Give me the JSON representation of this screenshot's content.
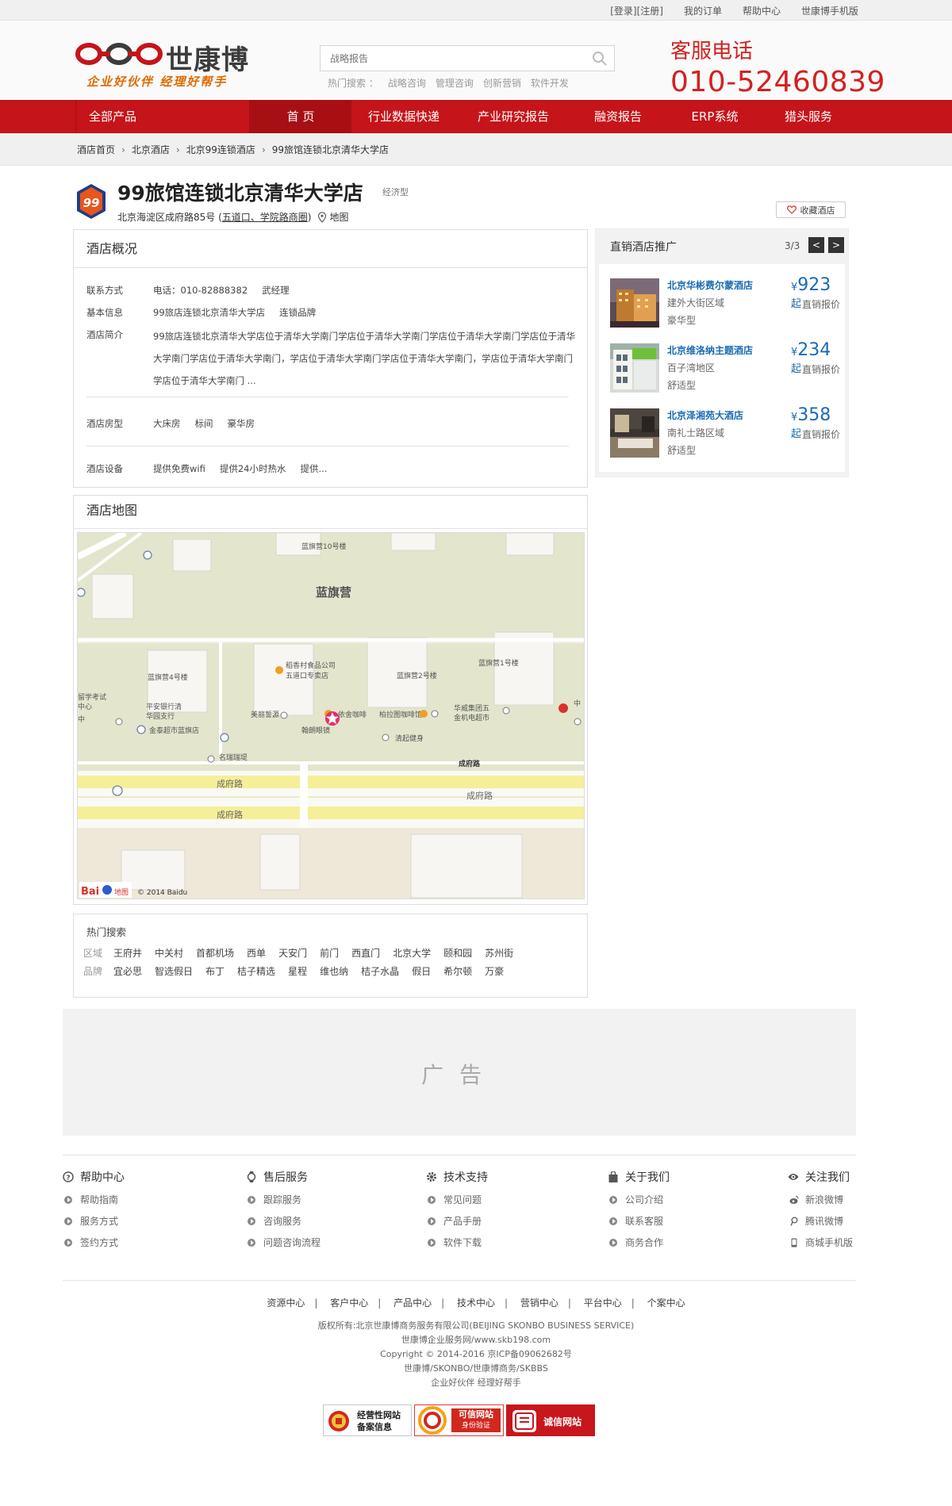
{
  "topbar": {
    "login": "[登录]",
    "register": "[注册]",
    "orders": "我的订单",
    "help": "帮助中心",
    "mobile": "世康博手机版"
  },
  "header": {
    "brand_name": "世康博",
    "slogan": "企业好伙伴  经理好帮手",
    "search_placeholder": "战略报告",
    "hot_label": "热门搜索 ：",
    "hot_items": [
      "战略咨询",
      "管理咨询",
      "创新营销",
      "软件开发"
    ],
    "hotline_title": "客服电话",
    "hotline_number": "010-52460839"
  },
  "nav": {
    "all": "全部产品",
    "items": [
      "首 页",
      "行业数据快递",
      "产业研究报告",
      "融资报告",
      "ERP系统",
      "猎头服务"
    ]
  },
  "breadcrumb": [
    "酒店首页",
    "北京酒店",
    "北京99连锁酒店",
    "99旅馆连锁北京清华大学店"
  ],
  "hotel": {
    "logo_text": "99",
    "name": "99旅馆连锁北京清华大学店",
    "type": "经济型",
    "address_prefix": "北京海淀区成府路85号 (",
    "address_area": "五道口、学院路商圈",
    "address_suffix": ")",
    "map_link": "地图",
    "favorite": "收藏酒店"
  },
  "overview": {
    "title": "酒店概况",
    "contact_label": "联系方式",
    "contact_phone": "电话：010-82888382",
    "contact_person": "武经理",
    "basic_label": "基本信息",
    "basic_name": "99旅店连锁北京清华大学店",
    "basic_brand": "连锁品牌",
    "intro_label": "酒店简介",
    "intro_text": "99旅店连锁北京清华大学店位于清华大学南门学店位于清华大学南门学店位于清华大学南门学店位于清华大学南门学店位于清华大学南门，学店位于清华大学南门学店位于清华大学南门，学店位于清华大学南门学店位于清华大学南门 ...",
    "rooms_label": "酒店房型",
    "rooms": [
      "大床房",
      "标间",
      "豪华房"
    ],
    "facilities_label": "酒店设备",
    "facilities": [
      "提供免费wifi",
      "提供24小时热水",
      "提供..."
    ]
  },
  "map": {
    "title": "酒店地图",
    "labels": {
      "district": "蓝旗营",
      "b10": "蓝旗营10号楼",
      "b4": "蓝旗营4号楼",
      "b2": "蓝旗营2号楼",
      "b1": "蓝旗营1号楼",
      "shop1": "稻香村食品公司",
      "shop2": "五道口专卖店",
      "bank1": "平安银行清",
      "bank2": "华园支行",
      "super": "金泰超市蓝旗店",
      "edu": "留学考试",
      "center": "中心",
      "mid": "中",
      "beauty": "美丽誓源",
      "glasses": "翰朗眼镜",
      "cafe": "依舍咖啡",
      "cafe2": "柏拉图咖啡馆",
      "tech1": "华威集团五",
      "tech2": "金机电超市",
      "gym": "清起健身",
      "mingrui": "名瑞瑞堤",
      "road1": "成府路",
      "road2": "成府路",
      "road3": "成府路",
      "road4": "成府路",
      "copyright": "© 2014 Baidu",
      "baidu": "Bai",
      "baidu2": "地图"
    }
  },
  "hot_search": {
    "title": "热门搜索",
    "area_label": "区域",
    "areas": [
      "王府井",
      "中关村",
      "首都机场",
      "西单",
      "天安门",
      "前门",
      "西直门",
      "北京大学",
      "颐和园",
      "苏州街"
    ],
    "brand_label": "品牌",
    "brands": [
      "宜必思",
      "智选假日",
      "布丁",
      "桔子精选",
      "星程",
      "维也纳",
      "桔子水晶",
      "假日",
      "希尔顿",
      "万豪"
    ]
  },
  "ad": {
    "label": "广告"
  },
  "promo": {
    "title": "直销酒店推广",
    "page": "3/3",
    "prev": "<",
    "next": ">",
    "hotels": [
      {
        "name": "北京华彬费尔蒙酒店",
        "area": "建外大街区域",
        "type": "豪华型",
        "currency": "¥",
        "price": "923",
        "unit": "起",
        "desc": "直销报价"
      },
      {
        "name": "北京维洛纳主题酒店",
        "area": "百子湾地区",
        "type": "舒适型",
        "currency": "¥",
        "price": "234",
        "unit": "起",
        "desc": "直销报价"
      },
      {
        "name": "北京泽湘苑大酒店",
        "area": "南礼士路区域",
        "type": "舒适型",
        "currency": "¥",
        "price": "358",
        "unit": "起",
        "desc": "直销报价"
      }
    ]
  },
  "footer": {
    "cols": [
      {
        "title": "帮助中心",
        "icon": "question-icon",
        "items": [
          "帮助指南",
          "服务方式",
          "签约方式"
        ]
      },
      {
        "title": "售后服务",
        "icon": "watch-icon",
        "items": [
          "跟踪服务",
          "咨询服务",
          "问题咨询流程"
        ]
      },
      {
        "title": "技术支持",
        "icon": "gear-icon",
        "items": [
          "常见问题",
          "产品手册",
          "软件下载"
        ]
      },
      {
        "title": "关于我们",
        "icon": "bag-icon",
        "items": [
          "公司介绍",
          "联系客服",
          "商务合作"
        ]
      },
      {
        "title": "关注我们",
        "icon": "eye-icon",
        "items": [
          "新浪微博",
          "腾讯微博",
          "商城手机版"
        ]
      }
    ],
    "links": [
      "资源中心",
      "客户中心",
      "产品中心",
      "技术中心",
      "营销中心",
      "平台中心",
      "个案中心"
    ],
    "copyright": [
      "版权所有:北京世康博商务服务有限公司(BEIJING SKONBO BUSINESS SERVICE)",
      "世康博企业服务网/www.skb198.com",
      "Copyright © 2014-2016 京ICP备09062682号",
      "世康博/SKONBO/世康博商务/SKBBS",
      "企业好伙伴 经理好帮手"
    ],
    "badges": [
      {
        "line1": "经营性网站",
        "line2": "备案信息"
      },
      {
        "line1": "可信网站",
        "line2": "身份验证"
      },
      {
        "line1": "诚信网站",
        "line2": ""
      }
    ]
  },
  "colors": {
    "brand_red": "#c6141b",
    "link_blue": "#1a6bb3",
    "accent_orange": "#e06a00"
  }
}
